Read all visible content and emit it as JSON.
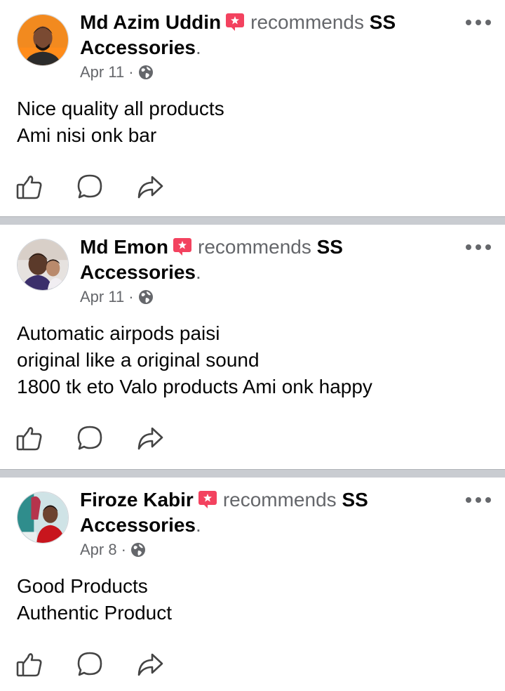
{
  "posts": [
    {
      "author": "Md Azim Uddin",
      "action": "recommends",
      "page_name_line1": "SS",
      "page_name_line2": "Accessories",
      "period": ".",
      "date": "Apr 11",
      "separator": "·",
      "body": [
        "Nice quality all products",
        "Ami nisi onk bar"
      ]
    },
    {
      "author": "Md Emon",
      "action": "recommends",
      "page_name_line1": "SS",
      "page_name_line2": "Accessories",
      "period": ".",
      "date": "Apr 11",
      "separator": "·",
      "body": [
        "Automatic airpods paisi",
        "original like a original sound",
        "1800 tk eto Valo products Ami onk happy"
      ]
    },
    {
      "author": "Firoze Kabir",
      "action": "recommends",
      "page_name_line1": "SS",
      "page_name_line2": "Accessories",
      "period": ".",
      "date": "Apr 8",
      "separator": "·",
      "body": [
        "Good Products",
        "Authentic Product"
      ]
    }
  ],
  "icons": {
    "badge": "recommend-star-badge-icon",
    "globe": "globe-icon",
    "more": "more-options-icon",
    "like": "like-icon",
    "comment": "comment-icon",
    "share": "share-icon"
  },
  "colors": {
    "secondary_text": "#65676b",
    "badge": "#f3425f",
    "divider": "#c9ccd1"
  }
}
